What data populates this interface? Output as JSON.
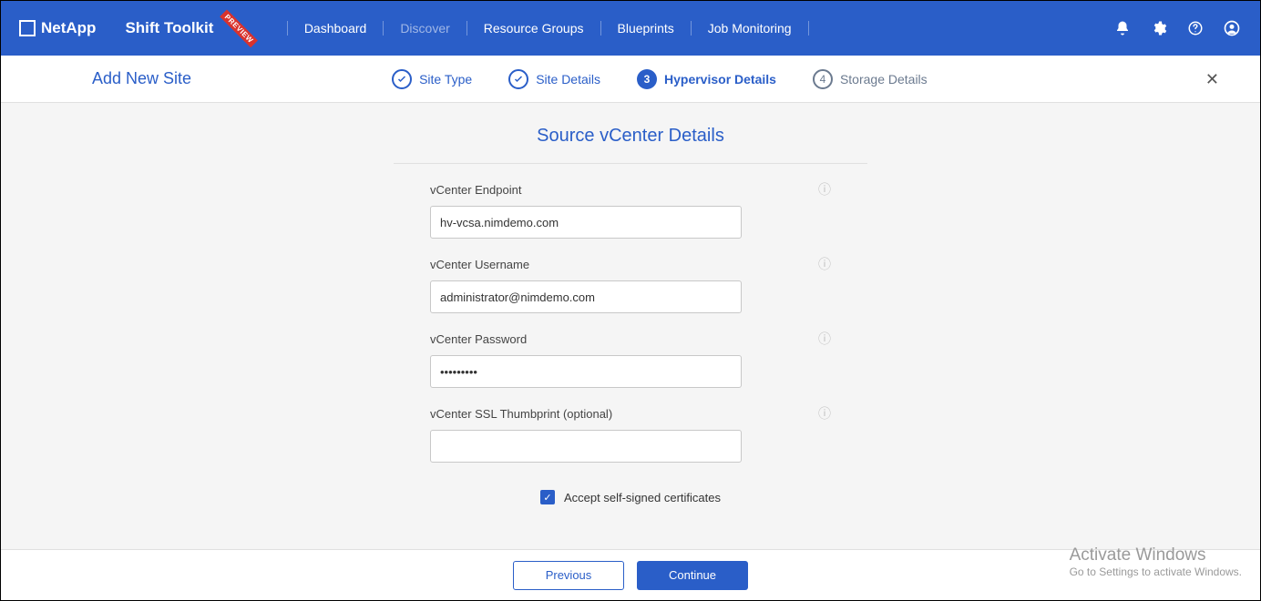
{
  "brand": "NetApp",
  "product": "Shift Toolkit",
  "badge": "PREVIEW",
  "nav": {
    "dashboard": "Dashboard",
    "discover": "Discover",
    "resource_groups": "Resource Groups",
    "blueprints": "Blueprints",
    "job_monitoring": "Job Monitoring"
  },
  "page_title": "Add New Site",
  "steps": {
    "s1": {
      "label": "Site Type"
    },
    "s2": {
      "label": "Site Details"
    },
    "s3": {
      "num": "3",
      "label": "Hypervisor Details"
    },
    "s4": {
      "num": "4",
      "label": "Storage Details"
    }
  },
  "form": {
    "title": "Source vCenter Details",
    "endpoint": {
      "label": "vCenter Endpoint",
      "value": "hv-vcsa.nimdemo.com"
    },
    "username": {
      "label": "vCenter Username",
      "value": "administrator@nimdemo.com"
    },
    "password": {
      "label": "vCenter Password",
      "value": "•••••••••"
    },
    "thumbprint": {
      "label": "vCenter SSL Thumbprint (optional)",
      "value": ""
    },
    "accept_cert": {
      "label": "Accept self-signed certificates",
      "checked": true
    }
  },
  "buttons": {
    "prev": "Previous",
    "cont": "Continue"
  },
  "watermark": {
    "t1": "Activate Windows",
    "t2": "Go to Settings to activate Windows."
  }
}
